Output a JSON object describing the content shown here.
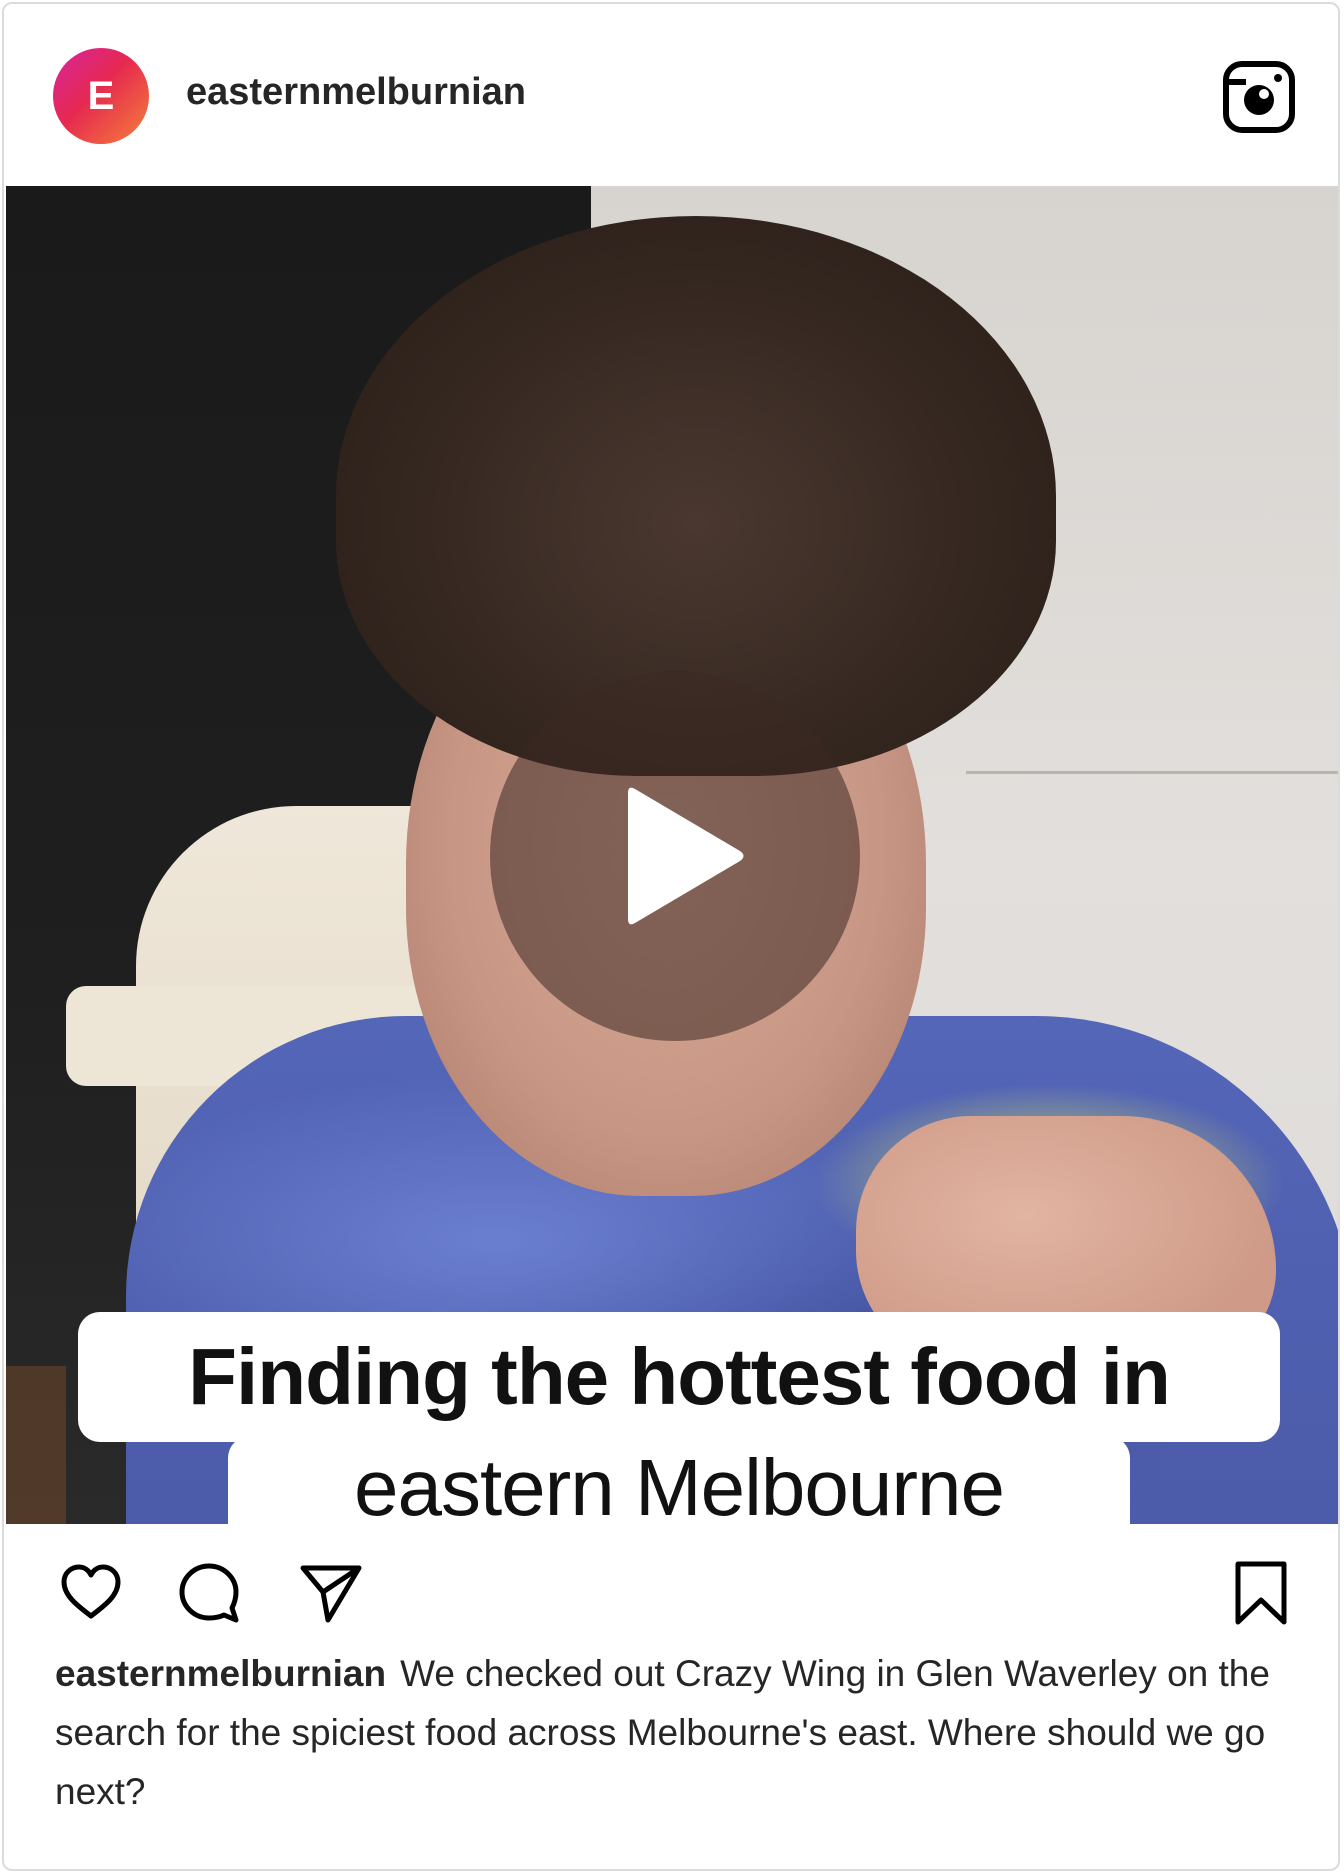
{
  "post": {
    "avatar_letter": "E",
    "username": "easternmelburnian",
    "video_caption_line1": "Finding the hottest food in",
    "video_caption_line2": "eastern Melbourne",
    "caption_username": "easternmelburnian",
    "caption_text": "We checked out Crazy Wing in Glen Waverley on the search for the spiciest food across Melbourne's east. Where should we go next?"
  },
  "icons": {
    "header": "instagram-icon",
    "play": "play-icon",
    "actions": [
      "heart-icon",
      "comment-icon",
      "share-icon",
      "bookmark-icon"
    ]
  },
  "colors": {
    "text": "#262626",
    "border": "#dbdbdb",
    "avatar_gradient_start": "#d6249f",
    "avatar_gradient_end": "#f5813a"
  }
}
